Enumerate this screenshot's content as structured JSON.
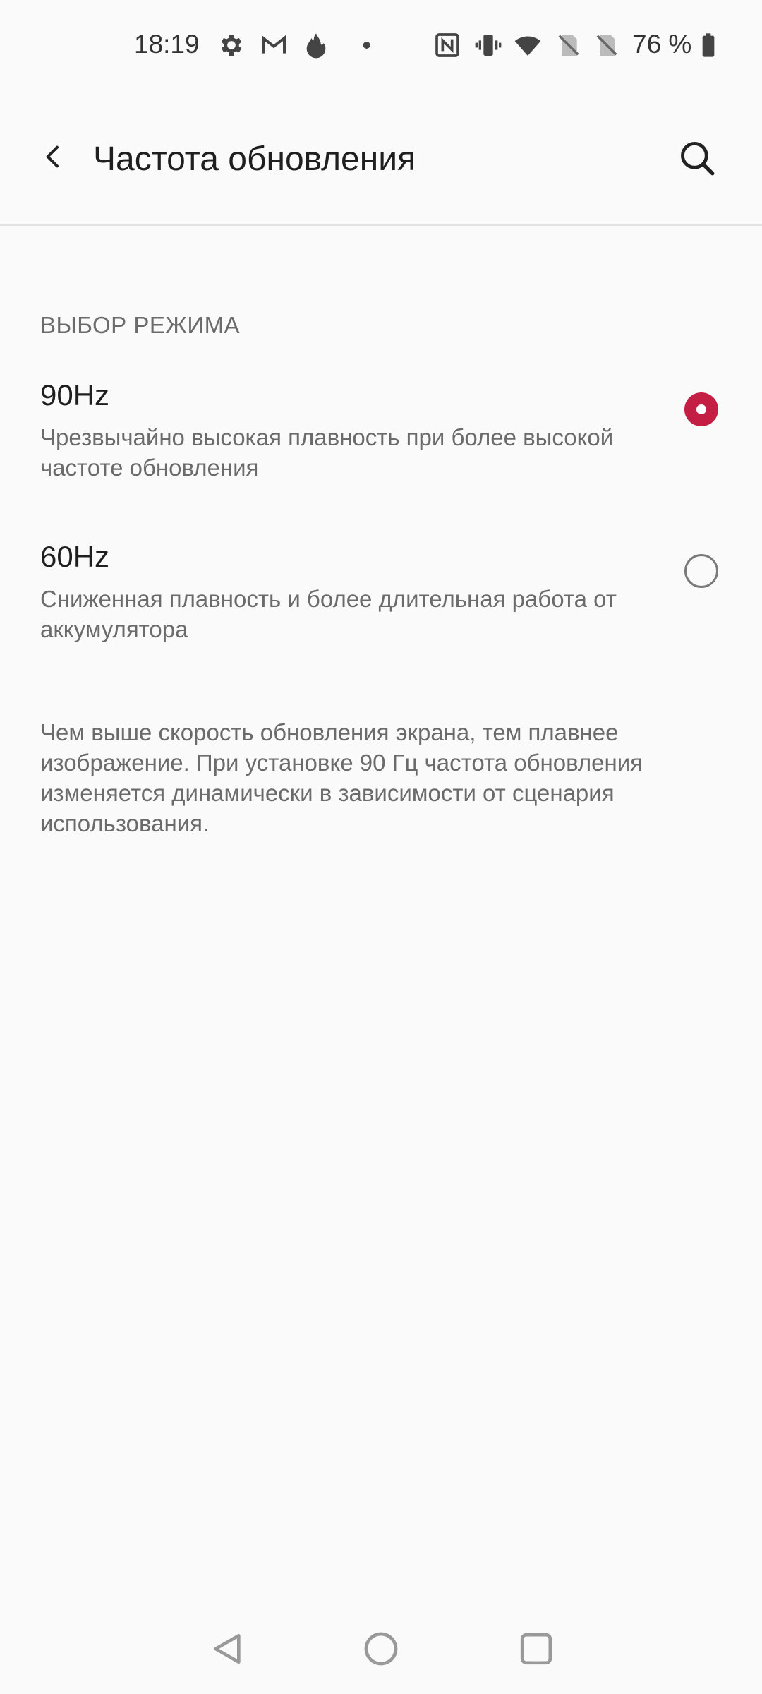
{
  "status_bar": {
    "time": "18:19",
    "battery_percent": "76 %",
    "icons": [
      "gear-icon",
      "gmail-icon",
      "fire-icon",
      "dot-icon",
      "nfc-icon",
      "vibrate-icon",
      "wifi-icon",
      "no-sim-icon",
      "no-sim-icon",
      "battery-icon"
    ]
  },
  "app_bar": {
    "title": "Частота обновления"
  },
  "section": {
    "header": "ВЫБОР РЕЖИМА"
  },
  "options": [
    {
      "title": "90Hz",
      "description": "Чрезвычайно высокая плавность при более высокой частоте обновления",
      "selected": true
    },
    {
      "title": "60Hz",
      "description": "Сниженная плавность и более длительная работа от аккумулятора",
      "selected": false
    }
  ],
  "footer_note": "Чем выше скорость обновления экрана, тем плавнее изображение. При установке 90 Гц частота обновления изменяется динамически в зависимости от сценария использования.",
  "colors": {
    "accent": "#c41e45",
    "background": "#fafafa",
    "primary_text": "#1f1f1f",
    "secondary_text": "#6b6b6b"
  }
}
